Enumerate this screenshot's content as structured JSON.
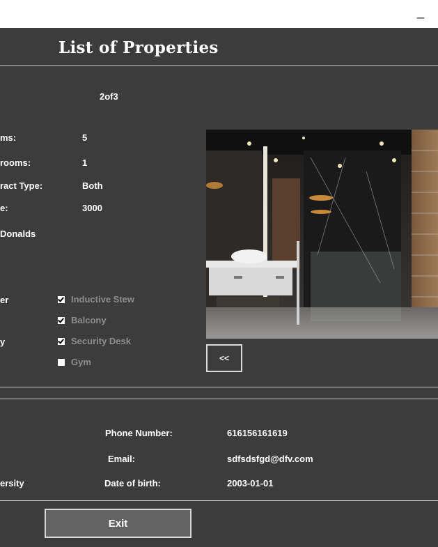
{
  "window": {
    "minimize_glyph": "_"
  },
  "header": {
    "title": "List of Properties"
  },
  "pager": {
    "text": "2of3"
  },
  "details": [
    {
      "label": "ms:",
      "value": "5"
    },
    {
      "label": "rooms:",
      "value": "1"
    },
    {
      "label": "ract Type:",
      "value": "Both"
    },
    {
      "label": "e:",
      "value": "3000"
    }
  ],
  "owner_name": "Donalds",
  "features_left": [
    "er",
    "",
    "y"
  ],
  "features": [
    {
      "label": "Inductive Stew",
      "checked": true
    },
    {
      "label": "Balcony",
      "checked": true
    },
    {
      "label": "Security Desk",
      "checked": true
    },
    {
      "label": "Gym",
      "checked": false
    }
  ],
  "image": {
    "alt": "bathroom-photo"
  },
  "prev_button": {
    "label": "<<"
  },
  "contact": {
    "phone_label": "Phone Number:",
    "phone_value": "616156161619",
    "email_label": "Email:",
    "email_value": "sdfsdsfgd@dfv.com",
    "left_cut_text": "ersity",
    "dob_label": "Date of birth:",
    "dob_value": "2003-01-01"
  },
  "exit_button": {
    "label": "Exit"
  },
  "colors": {
    "background": "#3c3c3c",
    "divider": "#cfcfcf",
    "disabled_text": "#8e8e8e"
  }
}
